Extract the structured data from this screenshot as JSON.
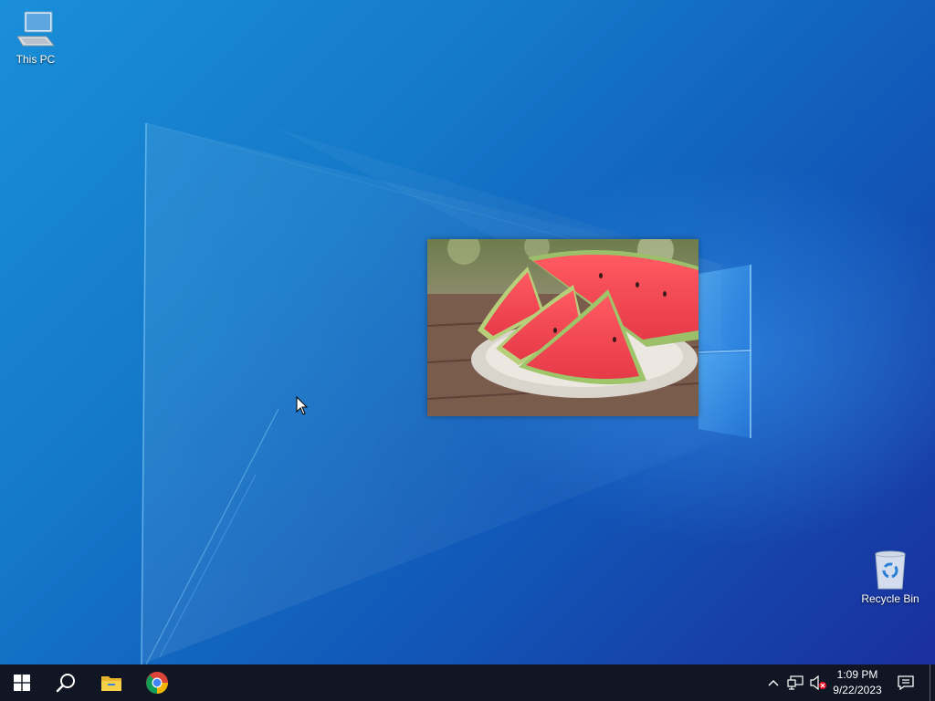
{
  "desktop": {
    "icons": [
      {
        "label": "This PC",
        "icon": "computer-icon"
      },
      {
        "label": "Recycle Bin",
        "icon": "recycle-bin-icon"
      }
    ],
    "image_window": {
      "subject": "watermelon-slices-photo"
    }
  },
  "taskbar": {
    "pinned": [
      {
        "icon": "windows-logo-icon"
      },
      {
        "icon": "search-icon"
      },
      {
        "icon": "file-explorer-icon"
      },
      {
        "icon": "chrome-icon"
      }
    ],
    "tray": {
      "time": "1:09 PM",
      "date": "9/22/2023",
      "icons": [
        "chevron-up-icon",
        "network-icon",
        "volume-muted-icon",
        "notification-icon"
      ]
    }
  },
  "colors": {
    "taskbar_bg": "#101624",
    "wallpaper_accent": "#1478c8"
  }
}
